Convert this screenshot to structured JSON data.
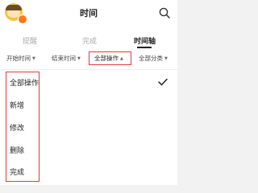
{
  "header": {
    "title": "时间",
    "avatar_icon": "avatar-icon",
    "search_icon": "search-icon"
  },
  "tabs": [
    {
      "label": "提醒"
    },
    {
      "label": "完成"
    },
    {
      "label": "时间轴",
      "active": true
    }
  ],
  "filters": [
    {
      "label": "开始时间"
    },
    {
      "label": "结束时间"
    },
    {
      "label": "全部操作",
      "active": true
    },
    {
      "label": "全部分类"
    }
  ],
  "dropdown": {
    "items": [
      {
        "label": "全部操作",
        "selected": true
      },
      {
        "label": "新增"
      },
      {
        "label": "修改"
      },
      {
        "label": "删除"
      },
      {
        "label": "完成"
      }
    ],
    "selected_icon": "check-icon"
  },
  "colors": {
    "highlight": "#e03a3a",
    "badge": "#ff7a1a"
  }
}
